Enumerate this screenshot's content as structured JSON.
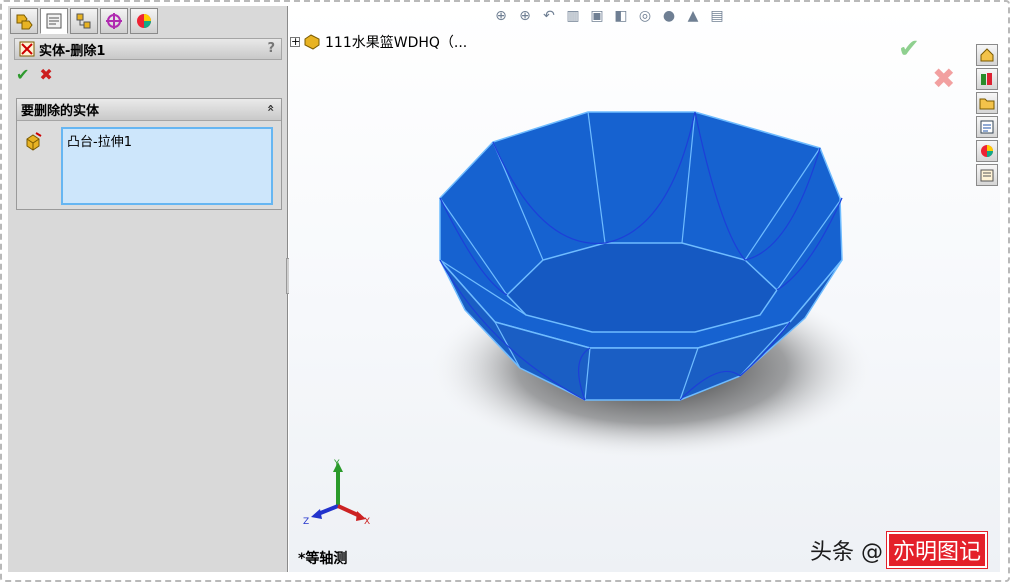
{
  "panel": {
    "title": "实体-删除1",
    "help": "?",
    "ok_symbol": "✔",
    "cancel_symbol": "✖",
    "group": {
      "title": "要删除的实体",
      "collapse_symbol": "«",
      "selected_items": [
        "凸台-拉伸1"
      ]
    },
    "tabs": [
      "featuremanager-icon",
      "propertymanager-icon",
      "configurationmanager-icon",
      "dimxpert-icon",
      "display-manager-icon"
    ]
  },
  "graphics": {
    "tree_expand": "+",
    "tree_label": "111水果篮WDHQ（...",
    "view_label": "*等轴测",
    "confirm_ok": "✔",
    "confirm_cancel": "✖",
    "triad": {
      "x": "X",
      "y": "Y",
      "z": "Z"
    }
  },
  "hud_icons": [
    "zoom-to-fit-icon",
    "zoom-area-icon",
    "previous-view-icon",
    "section-view-icon",
    "view-orientation-icon",
    "display-style-icon",
    "hide-show-icon",
    "edit-appearance-icon",
    "apply-scene-icon",
    "view-settings-icon"
  ],
  "taskpane_icons": [
    "home-icon",
    "design-library-icon",
    "file-explorer-icon",
    "view-palette-icon",
    "appearances-icon",
    "custom-properties-icon"
  ],
  "watermark": {
    "text": "头条 @",
    "stamp": "亦明图记"
  },
  "colors": {
    "model_blue": "#1466d8",
    "edge_blue": "#5fb2ff",
    "panel_bg": "#d9d9d9",
    "selection_bg": "#cde6fb"
  }
}
